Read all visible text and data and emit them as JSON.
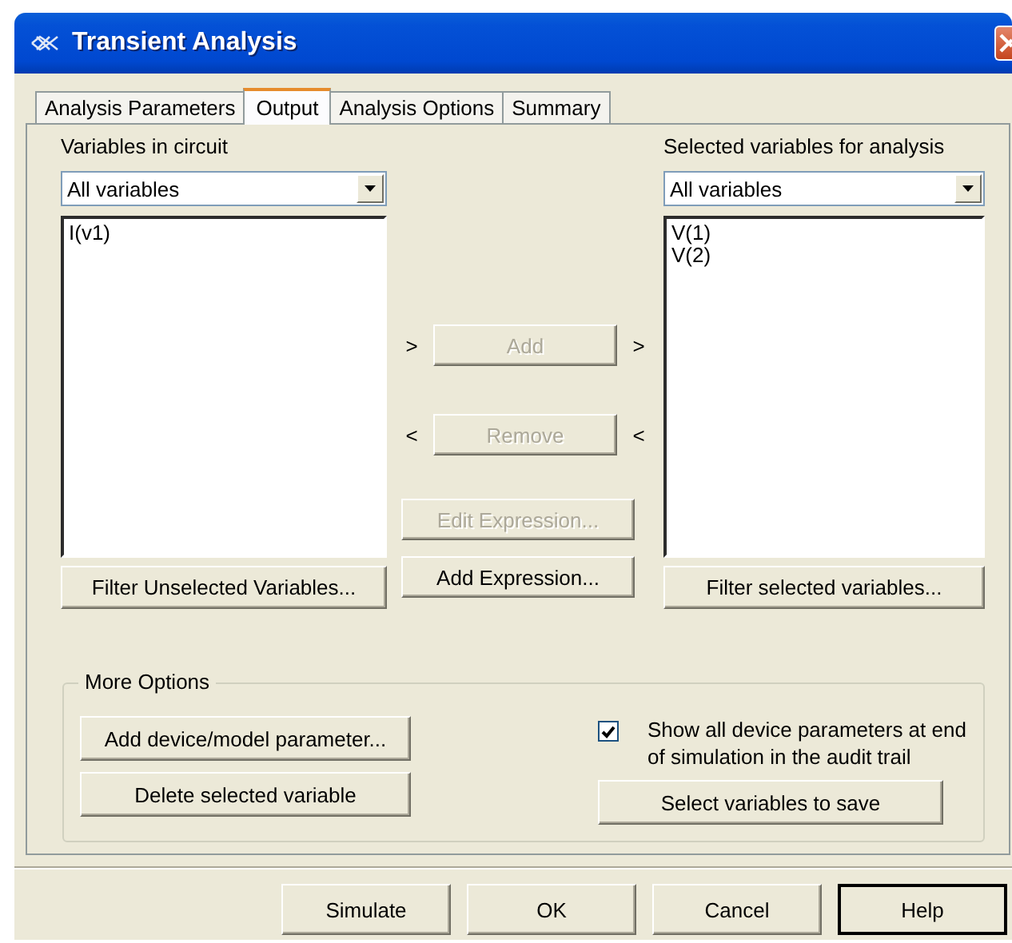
{
  "window": {
    "title": "Transient Analysis"
  },
  "tabs": [
    {
      "label": "Analysis Parameters",
      "selected": false
    },
    {
      "label": "Output",
      "selected": true
    },
    {
      "label": "Analysis Options",
      "selected": false
    },
    {
      "label": "Summary",
      "selected": false
    }
  ],
  "variables_in_circuit": {
    "label": "Variables in circuit",
    "filter": "All variables",
    "items": [
      "I(v1)"
    ],
    "filter_button": "Filter Unselected Variables..."
  },
  "transfer_buttons": [
    {
      "label": "Add",
      "disabled": true,
      "left_arrow": ">",
      "right_arrow": ">"
    },
    {
      "label": "Remove",
      "disabled": true,
      "left_arrow": "<",
      "right_arrow": "<"
    }
  ],
  "expression_buttons": [
    {
      "label": "Edit Expression...",
      "disabled": true
    },
    {
      "label": "Add Expression...",
      "disabled": false
    }
  ],
  "selected_variables": {
    "label": "Selected variables for analysis",
    "filter": "All variables",
    "items": [
      "V(1)",
      "V(2)"
    ],
    "filter_button": "Filter selected variables..."
  },
  "more_options": {
    "title": "More Options",
    "buttons": [
      "Add device/model parameter...",
      "Delete selected variable"
    ],
    "checkbox": {
      "label": "Show all device parameters at end of simulation in the audit trail",
      "checked": true
    },
    "save_button": "Select variables to save"
  },
  "footer_buttons": [
    {
      "label": "Simulate",
      "default": false
    },
    {
      "label": "OK",
      "default": false
    },
    {
      "label": "Cancel",
      "default": false
    },
    {
      "label": "Help",
      "default": true
    }
  ]
}
